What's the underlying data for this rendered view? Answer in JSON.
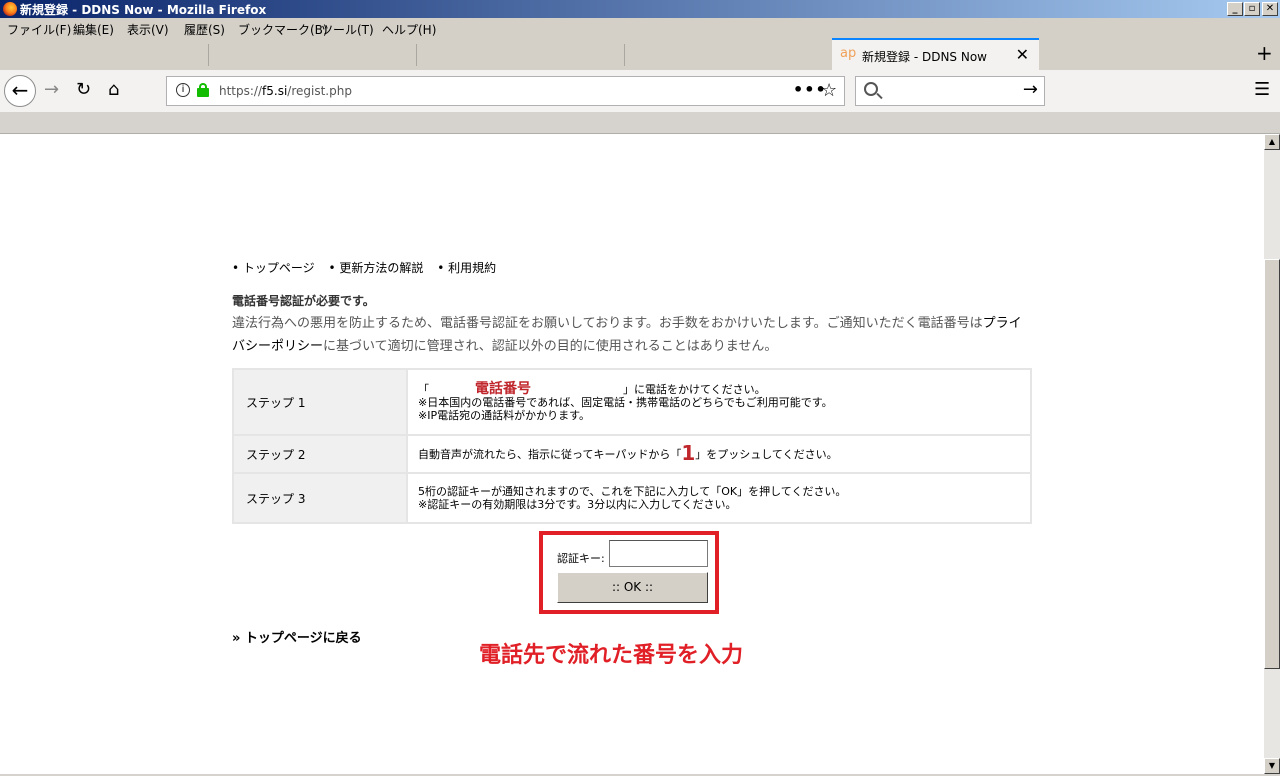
{
  "window": {
    "title": "新規登録 - DDNS Now - Mozilla Firefox",
    "min": "_",
    "max": "▫",
    "close": "✕"
  },
  "menu": {
    "file": "ファイル(F)",
    "edit": "編集(E)",
    "view": "表示(V)",
    "history": "履歴(S)",
    "bookmarks": "ブックマーク(B)",
    "tools": "ツール(T)",
    "help": "ヘルプ(H)"
  },
  "tabs": {
    "active_icon": "ap",
    "active_label": "新規登録 - DDNS Now",
    "close": "✕",
    "new_tab": "+"
  },
  "nav": {
    "back": "←",
    "forward": "→",
    "reload": "↻",
    "home": "⌂",
    "info": "i",
    "url_prefix": "https://",
    "url_host": "f5.si",
    "url_path": "/regist.php",
    "page_actions": "•••",
    "bookmark_star": "☆",
    "search_go": "→",
    "menu": "☰"
  },
  "scrollbar": {
    "up": "▲",
    "down": "▼"
  },
  "page": {
    "links": [
      "• トップページ",
      "• 更新方法の解説",
      "• 利用規約"
    ],
    "heading": "電話番号認証が必要です。",
    "desc_1": "違法行為への悪用を防止するため、電話番号認証をお願いしております。お手数をおかけいたします。ご通知いただく電話番号は",
    "desc_link": "プライバシーポリシー",
    "desc_2": "に基づいて適切に管理され、認証以外の目的に使用されることはありません。",
    "steps": [
      {
        "label": "ステップ 1",
        "open": "「",
        "phone": "電話番号",
        "close": "」に電話をかけてください。",
        "line2": "※日本国内の電話番号であれば、固定電話・携帯電話のどちらでもご利用可能です。",
        "line3": "※IP電話宛の通話料がかかります。"
      },
      {
        "label": "ステップ 2",
        "before": "自動音声が流れたら、指示に従ってキーパッドから「",
        "key": "1",
        "after": "」をプッシュしてください。"
      },
      {
        "label": "ステップ 3",
        "line1": "5桁の認証キーが通知されますので、これを下記に入力して「OK」を押してください。",
        "line2": "※認証キーの有効期限は3分です。3分以内に入力してください。"
      }
    ],
    "auth_label": "認証キー:",
    "auth_value": "",
    "ok_button": ":: OK ::",
    "back_link": "» トップページに戻る",
    "callout": "電話先で流れた番号を入力"
  }
}
